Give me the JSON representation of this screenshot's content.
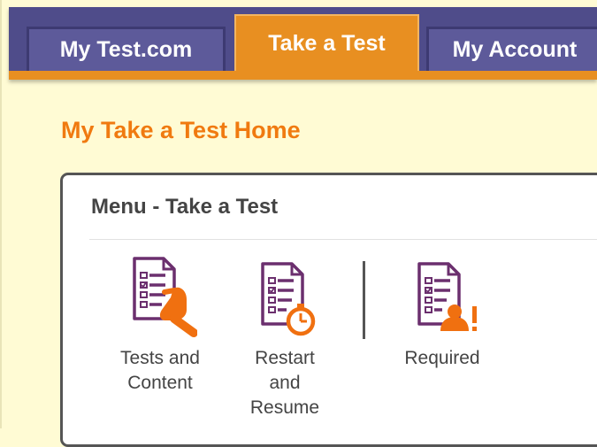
{
  "nav": {
    "tabs": [
      {
        "label": "My Test.com",
        "active": false
      },
      {
        "label": "Take a Test",
        "active": true
      },
      {
        "label": "My Account",
        "active": false
      }
    ]
  },
  "page": {
    "title": "My Take a Test Home"
  },
  "menu": {
    "title": "Menu - Take a Test",
    "items": [
      {
        "label_lines": [
          "Tests and",
          "Content"
        ],
        "icon": "tests-content-icon"
      },
      {
        "label_lines": [
          "Restart",
          "and",
          "Resume"
        ],
        "icon": "restart-resume-icon"
      },
      {
        "label_lines": [
          "Required"
        ],
        "icon": "required-icon"
      }
    ]
  },
  "colors": {
    "nav_bg": "#4f4c8a",
    "nav_accent": "#e88f21",
    "title_orange": "#f07a10",
    "icon_purple": "#6b2f6e",
    "icon_orange": "#f07010",
    "background": "#fffbd4"
  }
}
